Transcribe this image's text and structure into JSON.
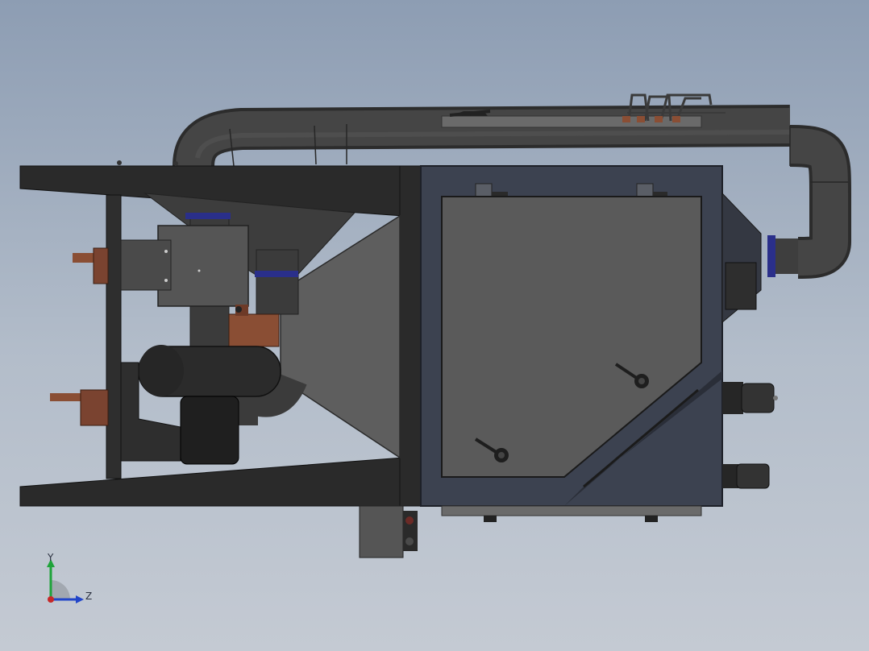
{
  "viewport": {
    "background_top": "#8d9db3",
    "background_bottom": "#c4cad3"
  },
  "model": {
    "frame_color": "#2a2a2a",
    "panel_color": "#5a5a5a",
    "housing_color": "#3c4250",
    "pipe_color": "#3a3a3a",
    "brass_color": "#8a4e34",
    "seal_color": "#2a2f8a"
  },
  "triad": {
    "y_label": "Y",
    "z_label": "Z",
    "y_color": "#1fa33a",
    "z_color": "#2145c9",
    "origin_color": "#c62828"
  }
}
